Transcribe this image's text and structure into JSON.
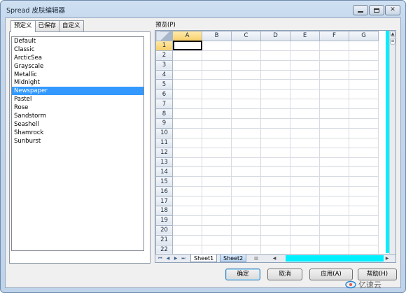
{
  "window": {
    "title": "Spread 皮肤编辑器"
  },
  "tabs": [
    {
      "label": "预定义",
      "active": true
    },
    {
      "label": "已保存",
      "active": false
    },
    {
      "label": "自定义",
      "active": false
    }
  ],
  "skins": [
    {
      "label": "Default",
      "selected": false
    },
    {
      "label": "Classic",
      "selected": false
    },
    {
      "label": "ArcticSea",
      "selected": false
    },
    {
      "label": "Grayscale",
      "selected": false
    },
    {
      "label": "Metallic",
      "selected": false
    },
    {
      "label": "Midnight",
      "selected": false
    },
    {
      "label": "Newspaper",
      "selected": true
    },
    {
      "label": "Pastel",
      "selected": false
    },
    {
      "label": "Rose",
      "selected": false
    },
    {
      "label": "Sandstorm",
      "selected": false
    },
    {
      "label": "Seashell",
      "selected": false
    },
    {
      "label": "Shamrock",
      "selected": false
    },
    {
      "label": "Sunburst",
      "selected": false
    }
  ],
  "preview": {
    "label": "预览(P)",
    "columns": [
      "A",
      "B",
      "C",
      "D",
      "E",
      "F",
      "G"
    ],
    "rows": [
      "1",
      "2",
      "3",
      "4",
      "5",
      "6",
      "7",
      "8",
      "9",
      "10",
      "11",
      "12",
      "13",
      "14",
      "15",
      "16",
      "17",
      "18",
      "19",
      "20",
      "21",
      "22"
    ],
    "sheet_tabs": [
      "Sheet1",
      "Sheet2"
    ],
    "active_sheet": "Sheet1",
    "accent_color": "#00f0ff"
  },
  "buttons": {
    "ok": "确定",
    "cancel": "取消",
    "apply": "应用(A)",
    "help": "帮助(H)"
  },
  "watermark": {
    "text": "亿速云"
  },
  "colors": {
    "selection": "#3399ff",
    "header_highlight": "#f7cf6a"
  }
}
